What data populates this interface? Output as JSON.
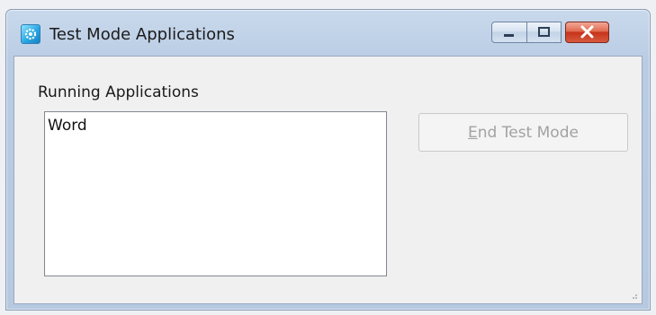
{
  "window": {
    "title": "Test Mode Applications",
    "icon": "app-settings-icon",
    "controls": [
      "minimize-icon",
      "maximize-icon",
      "close-icon"
    ]
  },
  "main": {
    "section_label": "Running Applications",
    "applications": [
      "Word"
    ],
    "end_button_label": "End Test Mode",
    "end_button_accesskey": "E",
    "end_button_enabled": false
  },
  "colors": {
    "title_bar": "#c9d9ec",
    "close_button": "#d64a30",
    "client_background": "#f0f0f0"
  }
}
